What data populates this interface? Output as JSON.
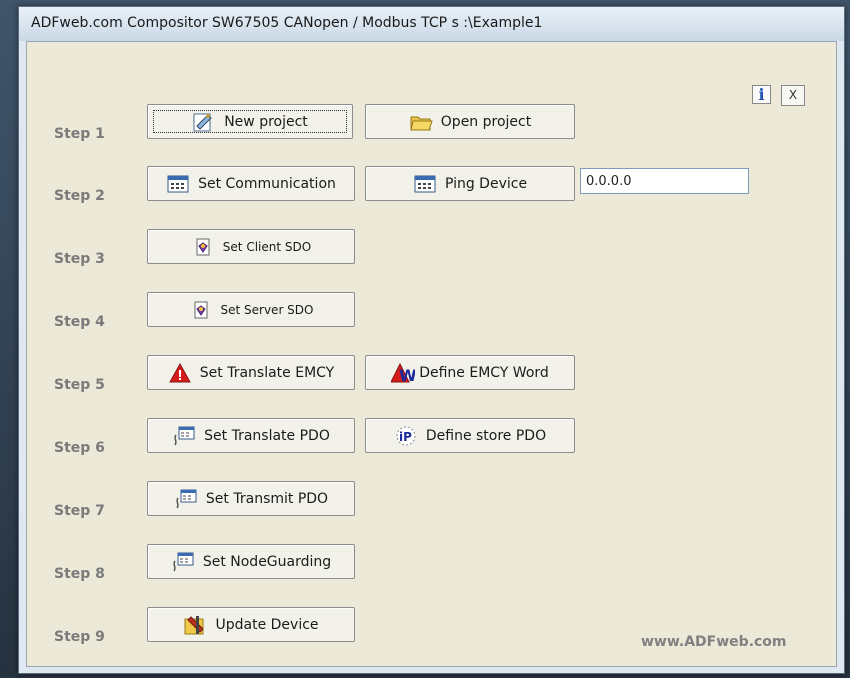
{
  "window": {
    "title": "ADFweb.com Compositor SW67505 CANopen / Modbus TCP s :\\Example1",
    "info_label": "i",
    "close_label": "X"
  },
  "steps": [
    {
      "label": "Step 1"
    },
    {
      "label": "Step 2"
    },
    {
      "label": "Step 3"
    },
    {
      "label": "Step 4"
    },
    {
      "label": "Step 5"
    },
    {
      "label": "Step 6"
    },
    {
      "label": "Step 7"
    },
    {
      "label": "Step 8"
    },
    {
      "label": "Step 9"
    }
  ],
  "buttons": {
    "new_project": "New project",
    "open_project": "Open project",
    "set_communication": "Set Communication",
    "ping_device": "Ping Device",
    "set_client_sdo": "Set Client SDO",
    "set_server_sdo": "Set Server SDO",
    "set_translate_emcy": "Set Translate EMCY",
    "define_emcy_word": "Define EMCY Word",
    "set_translate_pdo": "Set Translate PDO",
    "define_store_pdo": "Define store PDO",
    "set_transmit_pdo": "Set Transmit PDO",
    "set_nodeguarding": "Set NodeGuarding",
    "update_device": "Update Device"
  },
  "ping": {
    "ip_value": "0.0.0.0"
  },
  "footer": {
    "brand": "www.ADFweb.com"
  },
  "icons": {
    "new_project": "new-project-icon",
    "open_project": "folder-icon",
    "communication": "window-settings-icon",
    "sdo": "sdo-icon",
    "emcy": "warning-icon",
    "emcy_word": "warning-w-icon",
    "pdo": "pdo-icon",
    "store_pdo": "ip-icon",
    "update": "update-tools-icon"
  }
}
